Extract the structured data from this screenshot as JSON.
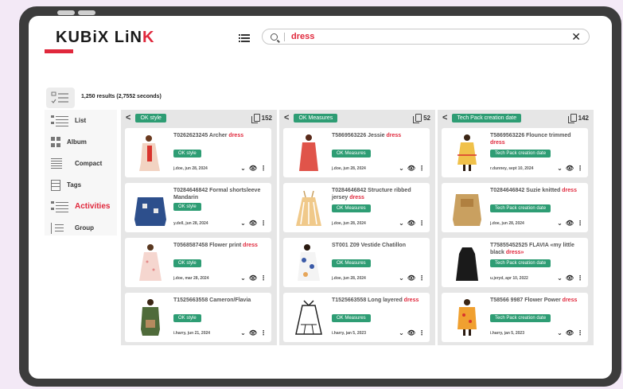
{
  "app": {
    "logo_main": "KUBiX LiN",
    "logo_accent": "K"
  },
  "search": {
    "query": "dress",
    "clear_label": "✕"
  },
  "results": {
    "summary": "1,250 results (2,7552 seconds)"
  },
  "views": [
    {
      "label": "List",
      "icon": "list-icon",
      "active": false
    },
    {
      "label": "Album",
      "icon": "album-grid-icon",
      "active": false
    },
    {
      "label": "Compact",
      "icon": "compact-lines-icon",
      "active": false
    },
    {
      "label": "Tags",
      "icon": "tags-icon",
      "active": false
    },
    {
      "label": "Activities",
      "icon": "activities-list-icon",
      "active": true
    },
    {
      "label": "Group",
      "icon": "group-icon",
      "active": false
    }
  ],
  "columns": [
    {
      "label": "OK style",
      "count": "152",
      "cards": [
        {
          "code": "T0262623245 Archer",
          "hl": "dress",
          "badge": "OK style",
          "meta": "j.doe, jun 28, 2024"
        },
        {
          "code": "T0284646842 Formal shortsleeve Mandarin",
          "hl": "",
          "badge": "OK style",
          "meta": "y.dell, jun 28, 2024"
        },
        {
          "code": "T0568587458 Flower print",
          "hl": "dress",
          "badge": "OK style",
          "meta": "j.doe, mar 28, 2024"
        },
        {
          "code": "T1525663558 Cameron/Flavia",
          "hl": "",
          "badge": "OK style",
          "meta": "i.harry, jun 21, 2024"
        }
      ]
    },
    {
      "label": "OK Measures",
      "count": "52",
      "cards": [
        {
          "code": "T5869563226 Jessie",
          "hl": "dress",
          "badge": "OK Measures",
          "meta": "j.doe, jun 28, 2024"
        },
        {
          "code": "T0284646842 Structure ribbed jersey",
          "hl": "dress",
          "badge": "OK Measures",
          "meta": "j.doe, jun 28, 2024"
        },
        {
          "code": "ST001 Z09 Vestide Chatillon",
          "hl": "",
          "badge": "OK Measures",
          "meta": "j.doe, jun 28, 2024"
        },
        {
          "code": "T1525663558 Long layered",
          "hl": "dress",
          "badge": "OK Measures",
          "meta": "i.harry, jan 5, 2023"
        }
      ]
    },
    {
      "label": "Tech Pack creation date",
      "count": "142",
      "cards": [
        {
          "code": "T5869563226 Flounce trimmed",
          "hl": "dress",
          "badge": "Tech Pack creation date",
          "meta": "r.dunney, sept 10, 2024"
        },
        {
          "code": "T0284646842 Suzie knitted",
          "hl": "dress",
          "badge": "Tech Pack creation date",
          "meta": "j.doe, jun 28, 2024"
        },
        {
          "code": "T75855452525 FLAVIA «my little black",
          "hl": "dress»",
          "badge": "Tech Pack creation date",
          "meta": "u.jeryd, apr 10, 2022"
        },
        {
          "code": "T58566 9987 Flower Power",
          "hl": "dress",
          "badge": "Tech Pack creation date",
          "meta": "i.harry, jan 5, 2023"
        }
      ]
    }
  ],
  "card_actions": {
    "expand": "⌄",
    "view": "👁",
    "more": "⋮"
  }
}
